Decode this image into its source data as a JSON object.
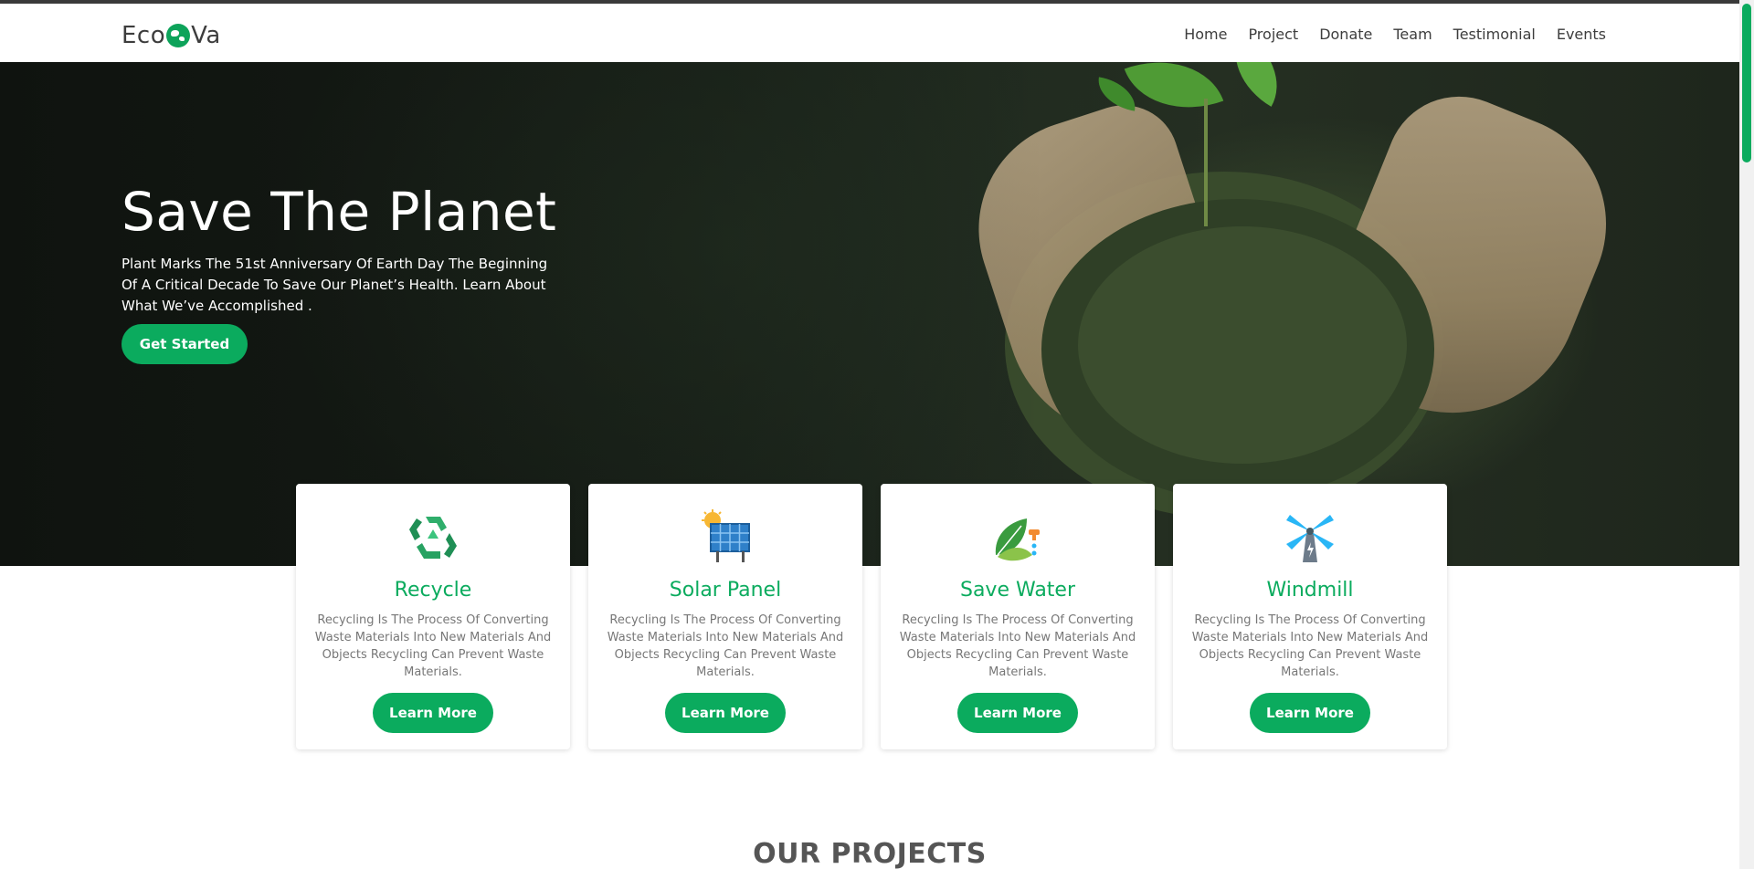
{
  "brand": {
    "logo_left": "Eco",
    "logo_right": "Va",
    "accent_color": "#0bab5e"
  },
  "nav": {
    "items": [
      {
        "label": "Home"
      },
      {
        "label": "Project"
      },
      {
        "label": "Donate"
      },
      {
        "label": "Team"
      },
      {
        "label": "Testimonial"
      },
      {
        "label": "Events"
      }
    ]
  },
  "hero": {
    "title": "Save The Planet",
    "description": "Plant Marks The 51st Anniversary Of Earth Day The Beginning Of A Critical Decade To Save Our Planet’s Health. Learn About What We’ve Accomplished .",
    "cta_label": "Get Started"
  },
  "features": [
    {
      "icon": "recycle-icon",
      "title": "Recycle",
      "text": "Recycling Is The Process Of Converting Waste Materials Into New Materials And Objects Recycling Can Prevent Waste Materials.",
      "button": "Learn More"
    },
    {
      "icon": "solar-panel-icon",
      "title": "Solar Panel",
      "text": "Recycling Is The Process Of Converting Waste Materials Into New Materials And Objects Recycling Can Prevent Waste Materials.",
      "button": "Learn More"
    },
    {
      "icon": "water-leaf-icon",
      "title": "Save Water",
      "text": "Recycling Is The Process Of Converting Waste Materials Into New Materials And Objects Recycling Can Prevent Waste Materials.",
      "button": "Learn More"
    },
    {
      "icon": "windmill-icon",
      "title": "Windmill",
      "text": "Recycling Is The Process Of Converting Waste Materials Into New Materials And Objects Recycling Can Prevent Waste Materials.",
      "button": "Learn More"
    }
  ],
  "projects": {
    "heading": "OUR PROJECTS"
  }
}
